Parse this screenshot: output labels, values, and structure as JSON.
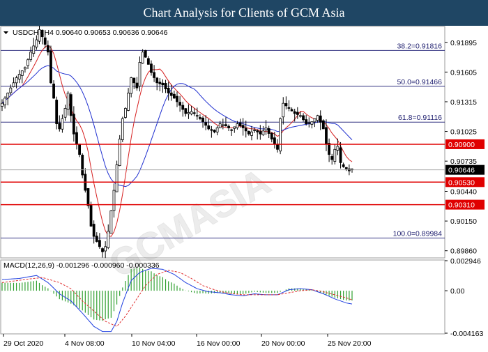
{
  "header": {
    "title": "Chart Analysis for Clients of GCM Asia"
  },
  "colors": {
    "title_bg": "#1f4664",
    "bull_candle": "#ffffff",
    "bear_candle": "#000000",
    "ma_fast": "#d62020",
    "ma_slow": "#2030d0",
    "level_line": "#e00000",
    "fib_line": "#303080",
    "macd_hist": "#30a030",
    "macd_line": "#2040e0",
    "signal_line": "#e03030"
  },
  "chart_data": {
    "type": "candlestick",
    "symbol_info": "USDCHF,H4  0.90640 0.90653 0.90636 0.90646",
    "price_ylim": [
      0.8979,
      0.9205
    ],
    "price_ticks": [
      "0.91895",
      "0.91605",
      "0.91315",
      "0.91025",
      "0.90735",
      "0.90440",
      "0.90150",
      "0.89860"
    ],
    "x_tick_labels": [
      "29 Oct 2020",
      "4 Nov 08:00",
      "10 Nov 04:00",
      "16 Nov 00:00",
      "20 Nov 00:00",
      "25 Nov 20:00"
    ],
    "current_price_label": "0.90646",
    "levels": [
      {
        "label": "0.90900",
        "value": 0.909
      },
      {
        "label": "0.90530",
        "value": 0.9053
      },
      {
        "label": "0.90310",
        "value": 0.9031
      }
    ],
    "fib_levels": [
      {
        "label": "38.2=0.91816",
        "value": 0.91816
      },
      {
        "label": "50.0=0.91466",
        "value": 0.91466
      },
      {
        "label": "61.8=0.91116",
        "value": 0.91116
      },
      {
        "label": "100.0=0.89984",
        "value": 0.89984
      }
    ],
    "close_path": [
      [
        0,
        0.913
      ],
      [
        2,
        0.914
      ],
      [
        5,
        0.9155
      ],
      [
        8,
        0.9165
      ],
      [
        10,
        0.918
      ],
      [
        12,
        0.9192
      ],
      [
        13,
        0.9202
      ],
      [
        14,
        0.9195
      ],
      [
        16,
        0.918
      ],
      [
        17,
        0.915
      ],
      [
        18,
        0.9135
      ],
      [
        19,
        0.911
      ],
      [
        20,
        0.9105
      ],
      [
        22,
        0.9125
      ],
      [
        23,
        0.914
      ],
      [
        24,
        0.9118
      ],
      [
        25,
        0.91
      ],
      [
        26,
        0.909
      ],
      [
        27,
        0.908
      ],
      [
        28,
        0.906
      ],
      [
        29,
        0.9045
      ],
      [
        30,
        0.903
      ],
      [
        31,
        0.901
      ],
      [
        32,
        0.9
      ],
      [
        33,
        0.8995
      ],
      [
        34,
        0.899
      ],
      [
        35,
        0.8985
      ],
      [
        36,
        0.899
      ],
      [
        37,
        0.9005
      ],
      [
        38,
        0.9025
      ],
      [
        39,
        0.9045
      ],
      [
        40,
        0.907
      ],
      [
        41,
        0.9095
      ],
      [
        42,
        0.9115
      ],
      [
        43,
        0.9125
      ],
      [
        44,
        0.914
      ],
      [
        45,
        0.9155
      ],
      [
        46,
        0.915
      ],
      [
        47,
        0.9145
      ],
      [
        48,
        0.917
      ],
      [
        49,
        0.918
      ],
      [
        50,
        0.9175
      ],
      [
        51,
        0.9168
      ],
      [
        52,
        0.916
      ],
      [
        54,
        0.915
      ],
      [
        56,
        0.9148
      ],
      [
        58,
        0.914
      ],
      [
        60,
        0.9135
      ],
      [
        62,
        0.9128
      ],
      [
        64,
        0.912
      ],
      [
        66,
        0.9122
      ],
      [
        68,
        0.9118
      ],
      [
        70,
        0.9112
      ],
      [
        72,
        0.9105
      ],
      [
        74,
        0.9102
      ],
      [
        76,
        0.911
      ],
      [
        78,
        0.9108
      ],
      [
        80,
        0.9104
      ],
      [
        82,
        0.911
      ],
      [
        84,
        0.9106
      ],
      [
        86,
        0.91
      ],
      [
        88,
        0.9104
      ],
      [
        90,
        0.91
      ],
      [
        92,
        0.9106
      ],
      [
        94,
        0.9095
      ],
      [
        96,
        0.9085
      ],
      [
        97,
        0.9115
      ],
      [
        98,
        0.913
      ],
      [
        100,
        0.9125
      ],
      [
        102,
        0.912
      ],
      [
        104,
        0.9118
      ],
      [
        106,
        0.911
      ],
      [
        108,
        0.9112
      ],
      [
        110,
        0.9118
      ],
      [
        112,
        0.9105
      ],
      [
        113,
        0.909
      ],
      [
        114,
        0.908
      ],
      [
        115,
        0.9075
      ],
      [
        116,
        0.9085
      ],
      [
        117,
        0.9088
      ],
      [
        118,
        0.9072
      ],
      [
        119,
        0.9068
      ],
      [
        120,
        0.9066
      ],
      [
        121,
        0.9064
      ],
      [
        122,
        0.9065
      ]
    ],
    "macd": {
      "label": "MACD(12,26,9) -0.001296 -0.000960 -0.000336",
      "ylim": [
        -0.004163,
        0.002946
      ],
      "ticks": [
        "0.002946",
        "0.00",
        "-0.004163"
      ],
      "macd_path": [
        [
          0,
          0.0011
        ],
        [
          6,
          0.0012
        ],
        [
          12,
          0.0015
        ],
        [
          16,
          0.0008
        ],
        [
          20,
          -0.0003
        ],
        [
          24,
          -0.001
        ],
        [
          28,
          -0.0022
        ],
        [
          32,
          -0.0035
        ],
        [
          35,
          -0.004
        ],
        [
          38,
          -0.004
        ],
        [
          40,
          -0.003
        ],
        [
          42,
          -0.0012
        ],
        [
          45,
          0.001
        ],
        [
          48,
          0.0018
        ],
        [
          52,
          0.0022
        ],
        [
          56,
          0.0021
        ],
        [
          60,
          0.0016
        ],
        [
          64,
          0.0008
        ],
        [
          68,
          0.0002
        ],
        [
          72,
          -0.0001
        ],
        [
          76,
          -0.0002
        ],
        [
          80,
          -0.0004
        ],
        [
          84,
          -0.0005
        ],
        [
          88,
          -0.0003
        ],
        [
          92,
          -0.0004
        ],
        [
          96,
          -0.0004
        ],
        [
          100,
          0.0001
        ],
        [
          104,
          0.0002
        ],
        [
          108,
          0.0001
        ],
        [
          112,
          -0.0003
        ],
        [
          116,
          -0.0008
        ],
        [
          120,
          -0.0012
        ],
        [
          122,
          -0.0013
        ]
      ],
      "signal_path": [
        [
          0,
          0.0008
        ],
        [
          8,
          0.0011
        ],
        [
          14,
          0.0013
        ],
        [
          20,
          0.0008
        ],
        [
          24,
          0.0002
        ],
        [
          28,
          -0.001
        ],
        [
          32,
          -0.002
        ],
        [
          36,
          -0.003
        ],
        [
          40,
          -0.0035
        ],
        [
          43,
          -0.0025
        ],
        [
          46,
          -0.0012
        ],
        [
          50,
          0.0005
        ],
        [
          54,
          0.0016
        ],
        [
          58,
          0.002
        ],
        [
          62,
          0.0018
        ],
        [
          66,
          0.0012
        ],
        [
          70,
          0.0005
        ],
        [
          74,
          0.0001
        ],
        [
          78,
          -0.0002
        ],
        [
          84,
          -0.0004
        ],
        [
          90,
          -0.0004
        ],
        [
          96,
          -0.0004
        ],
        [
          100,
          -0.0002
        ],
        [
          104,
          0.0
        ],
        [
          108,
          0.0001
        ],
        [
          112,
          -0.0001
        ],
        [
          116,
          -0.0004
        ],
        [
          120,
          -0.0007
        ],
        [
          122,
          -0.0009
        ]
      ]
    }
  }
}
